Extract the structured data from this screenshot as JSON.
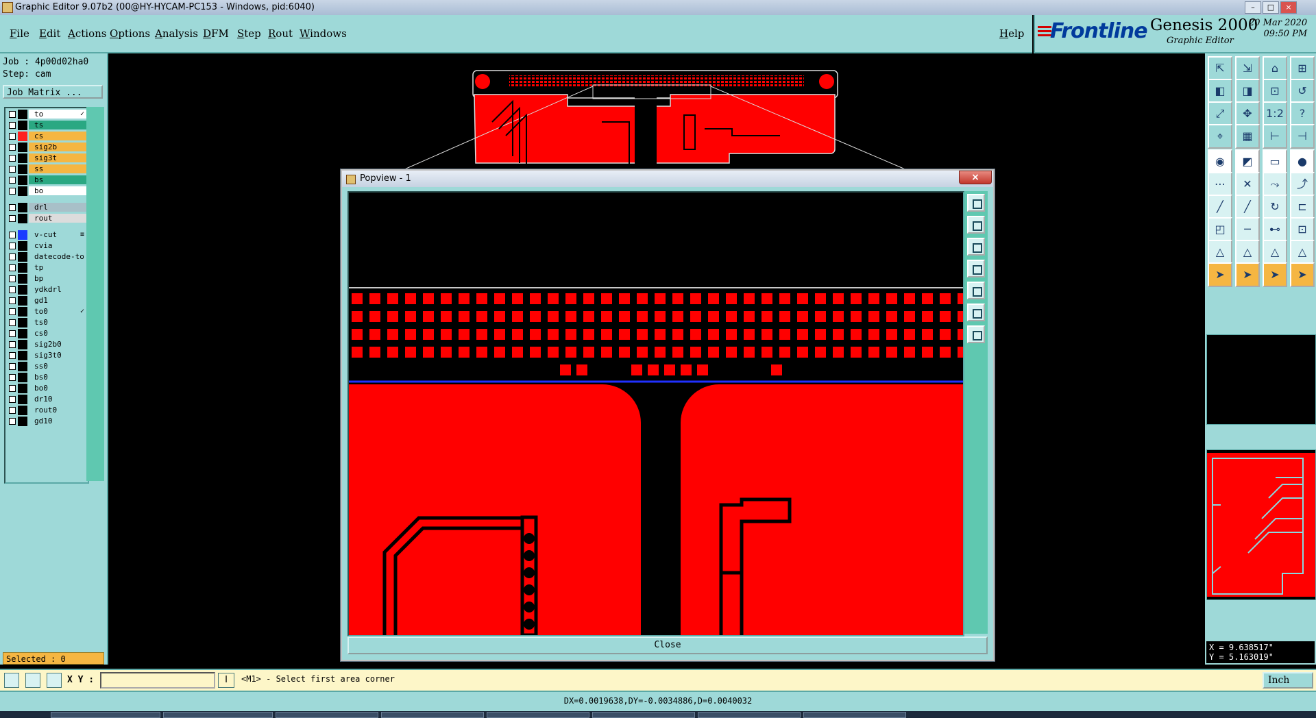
{
  "window": {
    "title": "Graphic Editor 9.07b2 (00@HY-HYCAM-PC153 - Windows, pid:6040)",
    "controls": [
      "–",
      "□",
      "×"
    ]
  },
  "menu": [
    "File",
    "Edit",
    "Actions",
    "Options",
    "Analysis",
    "DFM",
    "Step",
    "Rout",
    "Windows"
  ],
  "help_label": "Help",
  "brand": {
    "logo": "Frontline",
    "product": "Genesis 2000",
    "subtitle": "Graphic Editor",
    "date": "20 Mar 2020",
    "time": "09:50 PM"
  },
  "job": {
    "job_line": "Job : 4p00d02ha0",
    "step_line": "Step: cam",
    "job_matrix_button": "Job Matrix ..."
  },
  "layers": [
    {
      "name": "to",
      "color": "#ffffff",
      "flag": "✓"
    },
    {
      "name": "ts",
      "color": "#2aa882"
    },
    {
      "name": "cs",
      "color": "#f5b642",
      "swatch": "#ff2020"
    },
    {
      "name": "sig2b",
      "color": "#f5b642"
    },
    {
      "name": "sig3t",
      "color": "#f5b642"
    },
    {
      "name": "ss",
      "color": "#f5b642"
    },
    {
      "name": "bs",
      "color": "#2aa882"
    },
    {
      "name": "bo",
      "color": "#ffffff"
    },
    {
      "name": "drl",
      "color": "#a8c0c8"
    },
    {
      "name": "rout",
      "color": "#dcdcdc"
    },
    {
      "name": "v-cut",
      "color": "#9ed9d8",
      "swatch": "#1a3aff",
      "flag": "≡"
    },
    {
      "name": "cvia",
      "color": "#9ed9d8"
    },
    {
      "name": "datecode-to",
      "color": "#9ed9d8"
    },
    {
      "name": "tp",
      "color": "#9ed9d8"
    },
    {
      "name": "bp",
      "color": "#9ed9d8"
    },
    {
      "name": "ydkdrl",
      "color": "#9ed9d8"
    },
    {
      "name": "gd1",
      "color": "#9ed9d8"
    },
    {
      "name": "to0",
      "color": "#9ed9d8",
      "flag": "✓"
    },
    {
      "name": "ts0",
      "color": "#9ed9d8"
    },
    {
      "name": "cs0",
      "color": "#9ed9d8"
    },
    {
      "name": "sig2b0",
      "color": "#9ed9d8"
    },
    {
      "name": "sig3t0",
      "color": "#9ed9d8"
    },
    {
      "name": "ss0",
      "color": "#9ed9d8"
    },
    {
      "name": "bs0",
      "color": "#9ed9d8"
    },
    {
      "name": "bo0",
      "color": "#9ed9d8"
    },
    {
      "name": "dr10",
      "color": "#9ed9d8"
    },
    {
      "name": "rout0",
      "color": "#9ed9d8"
    },
    {
      "name": "gd10",
      "color": "#9ed9d8"
    }
  ],
  "selected_text": "Selected : 0",
  "popview": {
    "title": "Popview - 1",
    "close_x": "×",
    "close_button": "Close"
  },
  "coordinates": {
    "x": "X = 9.638517\"",
    "y": "Y = 5.163019\""
  },
  "command": {
    "xy_label": "X Y :",
    "xy_value": "",
    "info_icon": "I",
    "prompt": "<M1> - Select first area corner",
    "units": "Inch"
  },
  "status": "DX=0.0019638,DY=-0.0034886,D=0.0040032",
  "colors": {
    "panel": "#9ed9d8",
    "copper": "#ff0000",
    "highlight": "#f5b642",
    "accent_green": "#2aa882",
    "vcut": "#1a3aff"
  },
  "tool_icons": [
    "zoom-home-icon",
    "zoom-out-icon",
    "home-icon",
    "split-icon",
    "pan-left-icon",
    "pan-right-icon",
    "zoom-ratio-icon",
    "redraw-icon",
    "fit-icon",
    "center-icon",
    "one-to-two-icon",
    "help-icon",
    "snap-icon",
    "grid-icon",
    "measure-a-icon",
    "measure-b-icon",
    "select-icon",
    "draw-line-icon",
    "ruler-icon",
    "pad-icon",
    "node-icon",
    "cross-icon",
    "connect-icon",
    "link-icon",
    "line-red-icon",
    "line-blue-icon",
    "rotate-icon",
    "step-icon",
    "corner-icon",
    "horizontal-icon",
    "dim-icon",
    "tri-icon",
    "arc-a-icon",
    "arc-b-icon",
    "arc-c-icon",
    "arc-d-icon",
    "pointer-a-icon",
    "pointer-b-icon",
    "pointer-c-icon",
    "pointer-d-icon"
  ]
}
